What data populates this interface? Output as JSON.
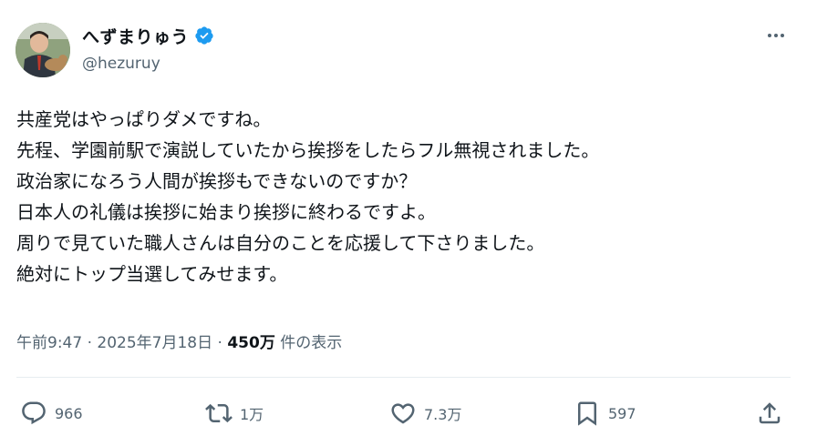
{
  "author": {
    "display_name": "へずまりゅう",
    "handle": "@hezuruy"
  },
  "post": {
    "lines": [
      "共産党はやっぱりダメですね。",
      "先程、学園前駅で演説していたから挨拶をしたらフル無視されました。",
      "政治家になろう人間が挨拶もできないのですか？",
      "日本人の礼儀は挨拶に始まり挨拶に終わるですよ。",
      "周りで見ていた職人さんは自分のことを応援して下さりました。",
      "絶対にトップ当選してみせます。"
    ],
    "time": "午前9:47",
    "date": "2025年7月18日",
    "separator": "·",
    "views": "450万",
    "views_label": "件の表示"
  },
  "actions": {
    "replies": "966",
    "reposts": "1万",
    "likes": "7.3万",
    "bookmarks": "597"
  },
  "colors": {
    "text": "#0f1419",
    "secondary": "#536471",
    "verified": "#1d9bf0"
  }
}
